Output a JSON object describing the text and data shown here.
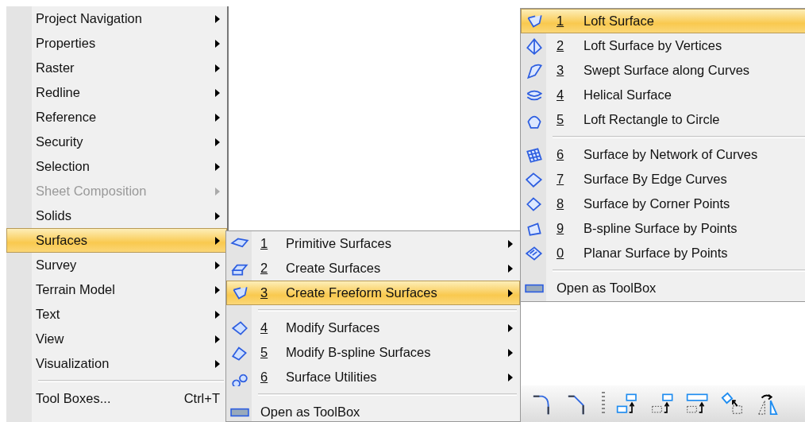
{
  "main_menu": {
    "items": [
      {
        "label": "Project Navigation",
        "submenu": true,
        "disabled": false,
        "selected": false
      },
      {
        "label": "Properties",
        "submenu": true,
        "disabled": false,
        "selected": false
      },
      {
        "label": "Raster",
        "submenu": true,
        "disabled": false,
        "selected": false
      },
      {
        "label": "Redline",
        "submenu": true,
        "disabled": false,
        "selected": false
      },
      {
        "label": "Reference",
        "submenu": true,
        "disabled": false,
        "selected": false
      },
      {
        "label": "Security",
        "submenu": true,
        "disabled": false,
        "selected": false
      },
      {
        "label": "Selection",
        "submenu": true,
        "disabled": false,
        "selected": false
      },
      {
        "label": "Sheet Composition",
        "submenu": true,
        "disabled": true,
        "selected": false
      },
      {
        "label": "Solids",
        "submenu": true,
        "disabled": false,
        "selected": false
      },
      {
        "label": "Surfaces",
        "submenu": true,
        "disabled": false,
        "selected": true
      },
      {
        "label": "Survey",
        "submenu": true,
        "disabled": false,
        "selected": false
      },
      {
        "label": "Terrain Model",
        "submenu": true,
        "disabled": false,
        "selected": false
      },
      {
        "label": "Text",
        "submenu": true,
        "disabled": false,
        "selected": false
      },
      {
        "label": "View",
        "submenu": true,
        "disabled": false,
        "selected": false
      },
      {
        "label": "Visualization",
        "submenu": true,
        "disabled": false,
        "selected": false
      }
    ],
    "tool_boxes": {
      "label": "Tool Boxes...",
      "shortcut": "Ctrl+T"
    }
  },
  "surfaces_submenu": {
    "groups": [
      [
        {
          "number": "1",
          "label": "Primitive Surfaces",
          "selected": false
        },
        {
          "number": "2",
          "label": "Create Surfaces",
          "selected": false
        },
        {
          "number": "3",
          "label": "Create Freeform Surfaces",
          "selected": true
        }
      ],
      [
        {
          "number": "4",
          "label": "Modify Surfaces",
          "selected": false
        },
        {
          "number": "5",
          "label": "Modify B-spline Surfaces",
          "selected": false
        },
        {
          "number": "6",
          "label": "Surface Utilities",
          "selected": false
        }
      ]
    ],
    "open_as_toolbox": "Open as ToolBox"
  },
  "freeform_submenu": {
    "groups": [
      [
        {
          "number": "1",
          "label": "Loft Surface",
          "selected": true
        },
        {
          "number": "2",
          "label": "Loft Surface by Vertices",
          "selected": false
        },
        {
          "number": "3",
          "label": "Swept Surface along Curves",
          "selected": false
        },
        {
          "number": "4",
          "label": "Helical Surface",
          "selected": false
        },
        {
          "number": "5",
          "label": "Loft Rectangle to Circle",
          "selected": false
        }
      ],
      [
        {
          "number": "6",
          "label": "Surface by Network of Curves",
          "selected": false
        },
        {
          "number": "7",
          "label": "Surface By Edge Curves",
          "selected": false
        },
        {
          "number": "8",
          "label": "Surface by Corner Points",
          "selected": false
        },
        {
          "number": "9",
          "label": "B-spline Surface by Points",
          "selected": false
        },
        {
          "number": "0",
          "label": "Planar Surface by Points",
          "selected": false
        }
      ]
    ],
    "open_as_toolbox": "Open as ToolBox"
  }
}
